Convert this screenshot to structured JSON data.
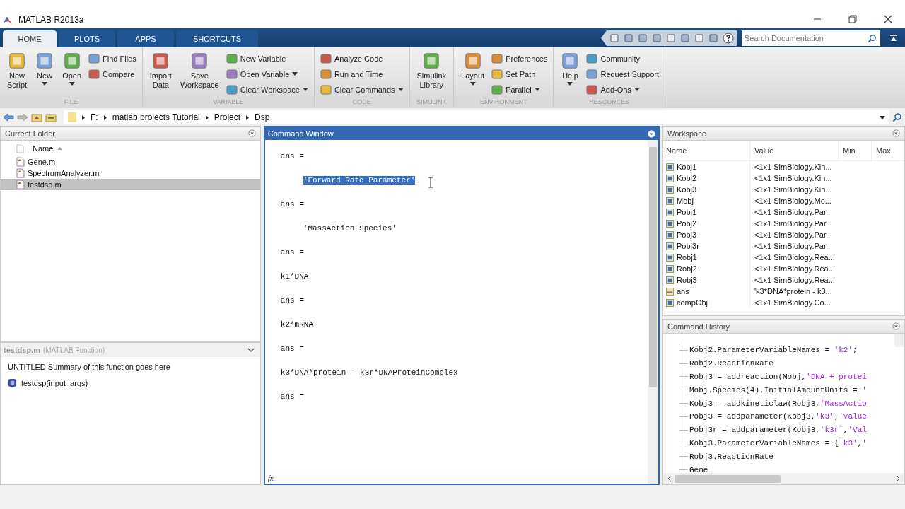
{
  "window": {
    "title": "MATLAB R2013a"
  },
  "tabs": [
    {
      "label": "HOME",
      "selected": true
    },
    {
      "label": "PLOTS",
      "selected": false
    },
    {
      "label": "APPS",
      "selected": false
    },
    {
      "label": "SHORTCUTS",
      "selected": false
    }
  ],
  "search": {
    "placeholder": "Search Documentation"
  },
  "ribbon": [
    {
      "label": "FILE",
      "items": [
        {
          "kind": "large",
          "label": "New\nScript",
          "dropdown": false
        },
        {
          "kind": "large",
          "label": "New",
          "dropdown": true
        },
        {
          "kind": "large",
          "label": "Open",
          "dropdown": true
        },
        {
          "kind": "stack",
          "items": [
            {
              "label": "Find Files",
              "dropdown": false
            },
            {
              "label": "Compare",
              "dropdown": false
            }
          ]
        }
      ]
    },
    {
      "label": "VARIABLE",
      "items": [
        {
          "kind": "large",
          "label": "Import\nData",
          "dropdown": false
        },
        {
          "kind": "large",
          "label": "Save\nWorkspace",
          "dropdown": false
        },
        {
          "kind": "stack",
          "items": [
            {
              "label": "New Variable",
              "dropdown": false
            },
            {
              "label": "Open Variable",
              "dropdown": true
            },
            {
              "label": "Clear Workspace",
              "dropdown": true
            }
          ]
        }
      ]
    },
    {
      "label": "CODE",
      "items": [
        {
          "kind": "stack",
          "items": [
            {
              "label": "Analyze Code",
              "dropdown": false
            },
            {
              "label": "Run and Time",
              "dropdown": false
            },
            {
              "label": "Clear Commands",
              "dropdown": true
            }
          ]
        }
      ]
    },
    {
      "label": "SIMULINK",
      "items": [
        {
          "kind": "large",
          "label": "Simulink\nLibrary",
          "dropdown": false
        }
      ]
    },
    {
      "label": "ENVIRONMENT",
      "items": [
        {
          "kind": "large",
          "label": "Layout",
          "dropdown": true
        },
        {
          "kind": "stack",
          "items": [
            {
              "label": "Preferences",
              "dropdown": false
            },
            {
              "label": "Set Path",
              "dropdown": false
            },
            {
              "label": "Parallel",
              "dropdown": true
            }
          ]
        }
      ]
    },
    {
      "label": "RESOURCES",
      "items": [
        {
          "kind": "large",
          "label": "Help",
          "dropdown": true
        },
        {
          "kind": "stack",
          "items": [
            {
              "label": "Community",
              "dropdown": false
            },
            {
              "label": "Request Support",
              "dropdown": false
            },
            {
              "label": "Add-Ons",
              "dropdown": true
            }
          ]
        }
      ]
    }
  ],
  "address": [
    "F:",
    "matlab projects Tutorial",
    "Project",
    "Dsp"
  ],
  "current_folder": {
    "title": "Current Folder",
    "column": "Name",
    "files": [
      {
        "name": "Gene.m",
        "selected": false
      },
      {
        "name": "SpectrumAnalyzer.m",
        "selected": false
      },
      {
        "name": "testdsp.m",
        "selected": true
      }
    ],
    "details": {
      "file": "testdsp.m",
      "type": "(MATLAB Function)",
      "summary": "UNTITLED Summary of this function goes here",
      "signature": "testdsp(input_args)"
    }
  },
  "command_window": {
    "title": "Command Window",
    "prompt_icon": "fx",
    "lines": [
      {
        "kind": "label",
        "text": "ans =",
        "selected": false
      },
      {
        "kind": "indented",
        "text": "'Forward Rate Parameter'",
        "selected": true
      },
      {
        "kind": "label",
        "text": "ans =",
        "selected": false
      },
      {
        "kind": "indented",
        "text": "'MassAction Species'",
        "selected": false
      },
      {
        "kind": "label",
        "text": "ans =",
        "selected": false
      },
      {
        "kind": "value",
        "text": "k1*DNA",
        "selected": false
      },
      {
        "kind": "label",
        "text": "ans =",
        "selected": false
      },
      {
        "kind": "value",
        "text": "k2*mRNA",
        "selected": false
      },
      {
        "kind": "label",
        "text": "ans =",
        "selected": false
      },
      {
        "kind": "value",
        "text": "k3*DNA*protein - k3r*DNAProteinComplex",
        "selected": false
      },
      {
        "kind": "label",
        "text": "ans =",
        "selected": false
      }
    ]
  },
  "workspace": {
    "title": "Workspace",
    "columns": [
      "Name",
      "Value",
      "Min",
      "Max"
    ],
    "rows": [
      {
        "kind": "object",
        "name": "Kobj1",
        "value": "<1x1 SimBiology.Kin..."
      },
      {
        "kind": "object",
        "name": "Kobj2",
        "value": "<1x1 SimBiology.Kin..."
      },
      {
        "kind": "object",
        "name": "Kobj3",
        "value": "<1x1 SimBiology.Kin..."
      },
      {
        "kind": "object",
        "name": "Mobj",
        "value": "<1x1 SimBiology.Mo..."
      },
      {
        "kind": "object",
        "name": "Pobj1",
        "value": "<1x1 SimBiology.Par..."
      },
      {
        "kind": "object",
        "name": "Pobj2",
        "value": "<1x1 SimBiology.Par..."
      },
      {
        "kind": "object",
        "name": "Pobj3",
        "value": "<1x1 SimBiology.Par..."
      },
      {
        "kind": "object",
        "name": "Pobj3r",
        "value": "<1x1 SimBiology.Par..."
      },
      {
        "kind": "object",
        "name": "Robj1",
        "value": "<1x1 SimBiology.Rea..."
      },
      {
        "kind": "object",
        "name": "Robj2",
        "value": "<1x1 SimBiology.Rea..."
      },
      {
        "kind": "object",
        "name": "Robj3",
        "value": "<1x1 SimBiology.Rea..."
      },
      {
        "kind": "char",
        "name": "ans",
        "value": "'k3*DNA*protein - k3..."
      },
      {
        "kind": "object",
        "name": "compObj",
        "value": "<1x1 SimBiology.Co..."
      }
    ]
  },
  "command_history": {
    "title": "Command History",
    "entries": [
      [
        {
          "kind": "code",
          "text": "Kobj2.ParameterVariableNames = "
        },
        {
          "kind": "string",
          "text": "'k2'"
        },
        {
          "kind": "code",
          "text": ";"
        }
      ],
      [
        {
          "kind": "code",
          "text": "Robj2.ReactionRate"
        }
      ],
      [
        {
          "kind": "code",
          "text": "Robj3 = addreaction(Mobj,"
        },
        {
          "kind": "string",
          "text": "'DNA + protei"
        }
      ],
      [
        {
          "kind": "code",
          "text": "Mobj.Species(4).InitialAmountUnits = "
        },
        {
          "kind": "string",
          "text": "'"
        }
      ],
      [
        {
          "kind": "code",
          "text": "Kobj3 = addkineticlaw(Robj3,"
        },
        {
          "kind": "string",
          "text": "'MassActio"
        }
      ],
      [
        {
          "kind": "code",
          "text": "Pobj3 = addparameter(Kobj3,"
        },
        {
          "kind": "string",
          "text": "'k3'"
        },
        {
          "kind": "code",
          "text": ","
        },
        {
          "kind": "string",
          "text": "'Value"
        }
      ],
      [
        {
          "kind": "code",
          "text": "Pobj3r = addparameter(Kobj3,"
        },
        {
          "kind": "string",
          "text": "'k3r'"
        },
        {
          "kind": "code",
          "text": ","
        },
        {
          "kind": "string",
          "text": "'Val"
        }
      ],
      [
        {
          "kind": "code",
          "text": "Kobj3.ParameterVariableNames = {"
        },
        {
          "kind": "string",
          "text": "'k3'"
        },
        {
          "kind": "code",
          "text": ","
        },
        {
          "kind": "string",
          "text": "'"
        }
      ],
      [
        {
          "kind": "code",
          "text": "Robj3.ReactionRate"
        }
      ],
      [
        {
          "kind": "code",
          "text": "Gene"
        }
      ]
    ]
  }
}
